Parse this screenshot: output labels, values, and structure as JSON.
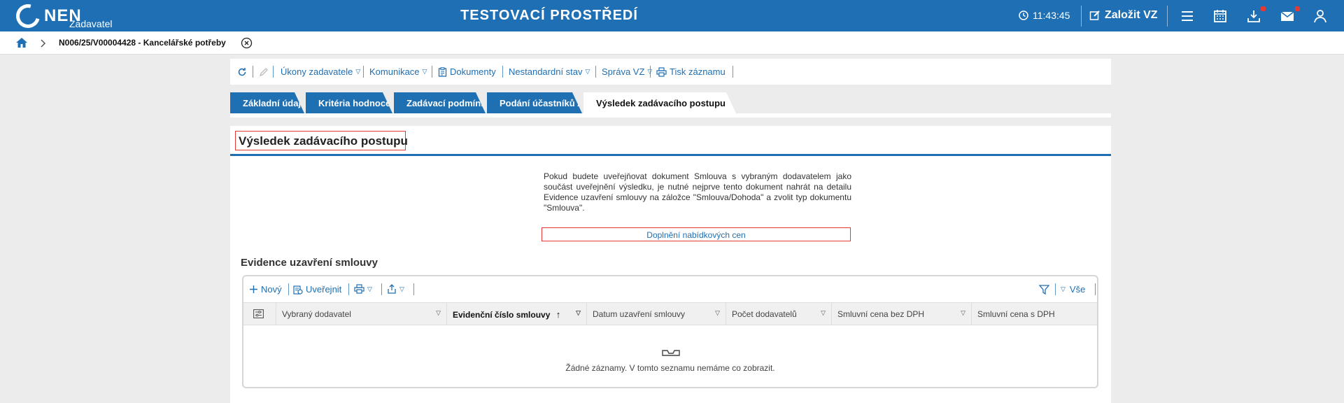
{
  "topbar": {
    "logo_text": "NEN",
    "logo_sub": "Zadavatel",
    "env_title": "TESTOVACÍ PROSTŘEDÍ",
    "clock": "11:43:45",
    "create_label": "Založit VZ",
    "bg_color": "#1e6fb3"
  },
  "breadcrumb": {
    "current": "N006/25/V00004428 - Kancelářské potřeby"
  },
  "toolbar": {
    "ukony": "Úkony zadavatele",
    "komunikace": "Komunikace",
    "dokumenty": "Dokumenty",
    "nestandardni": "Nestandardní stav",
    "sprava": "Správa VZ",
    "tisk": "Tisk záznamu"
  },
  "tabs": [
    {
      "label": "Základní údaje"
    },
    {
      "label": "Kritéria hodnocení"
    },
    {
      "label": "Zadávací podmínky"
    },
    {
      "label": "Podání účastníků ZP"
    },
    {
      "label": "Výsledek zadávacího postupu"
    }
  ],
  "main": {
    "section_title": "Výsledek zadávacího postupu",
    "notice": "Pokud budete uveřejňovat dokument Smlouva s vybraným dodavatelem jako součást uveřejnění výsledku, je nutné nejprve tento dokument nahrát na detailu Evidence uzavření smlouvy na záložce \"Smlouva/Dohoda\" a zvolit typ dokumentu \"Smlouva\".",
    "fill_link": "Doplnění nabídkových cen",
    "sub_title": "Evidence uzavření smlouvy"
  },
  "grid": {
    "new_label": "Nový",
    "publish_label": "Uveřejnit",
    "all_label": "Vše",
    "columns": [
      "Vybraný dodavatel",
      "Evidenční číslo smlouvy",
      "Datum uzavření smlouvy",
      "Počet dodavatelů",
      "Smluvní cena bez DPH",
      "Smluvní cena s DPH"
    ],
    "empty_text": "Žádné záznamy. V tomto seznamu nemáme co zobrazit."
  }
}
